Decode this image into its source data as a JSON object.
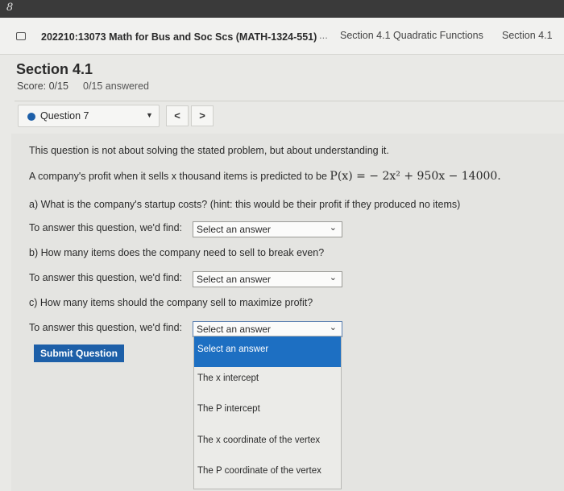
{
  "nav": {
    "course": "202210:13073 Math for Bus and Soc Scs (MATH-1324-551)",
    "ellipsis": "...",
    "breadcrumb": [
      "Section 4.1 Quadratic Functions",
      "Section 4.1"
    ]
  },
  "corner_glyph": "8",
  "section": {
    "title": "Section 4.1",
    "score": "Score: 0/15",
    "answered": "0/15 answered"
  },
  "question_nav": {
    "selected": "Question 7",
    "prev": "<",
    "next": ">"
  },
  "body": {
    "intro": "This question is not about solving the stated problem, but about understanding it.",
    "profit_prefix": "A company's profit when it sells x thousand items is predicted to be",
    "profit_formula": "P(x) = − 2x² + 950x − 14000.",
    "part_a": "a) What is the company's startup costs? (hint: this would be their profit if they produced no items)",
    "part_b": "b) How many items does the company need to sell to break even?",
    "part_c": "c) How many items should the company sell to maximize profit?",
    "prompt": "To answer this question, we'd find:"
  },
  "selects": {
    "a_value": "Select an answer",
    "b_value": "Select an answer",
    "c_value": "Select an answer"
  },
  "dropdown_options": [
    "Select an answer",
    "The x intercept",
    "The P intercept",
    "The x coordinate of the vertex",
    "The P coordinate of the vertex"
  ],
  "submit_label": "Submit Question",
  "colors": {
    "accent": "#1d5fa8",
    "highlight": "#1d6fc2"
  }
}
